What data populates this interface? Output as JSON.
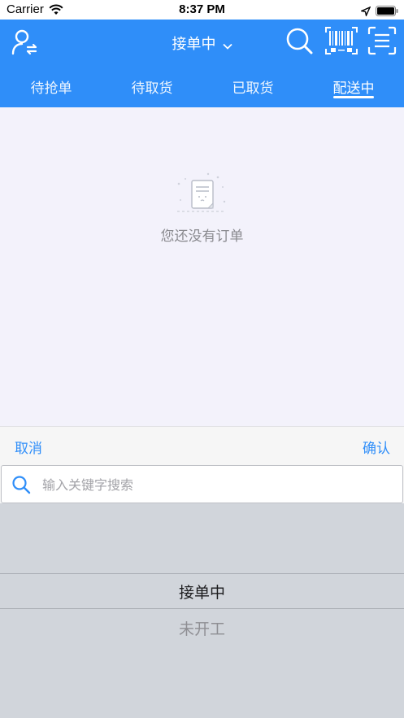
{
  "status_bar": {
    "carrier": "Carrier",
    "time": "8:37 PM"
  },
  "header": {
    "title": "接单中"
  },
  "tabs": [
    {
      "label": "待抢单"
    },
    {
      "label": "待取货"
    },
    {
      "label": "已取货"
    },
    {
      "label": "配送中"
    }
  ],
  "empty_state": {
    "message": "您还没有订单"
  },
  "picker": {
    "cancel_label": "取消",
    "confirm_label": "确认",
    "search_placeholder": "输入关键字搜索",
    "options": [
      "接单中",
      "未开工"
    ]
  },
  "colors": {
    "primary": "#2f8ef9",
    "content_bg": "#f3f2fb",
    "picker_bg": "#d1d5db"
  }
}
